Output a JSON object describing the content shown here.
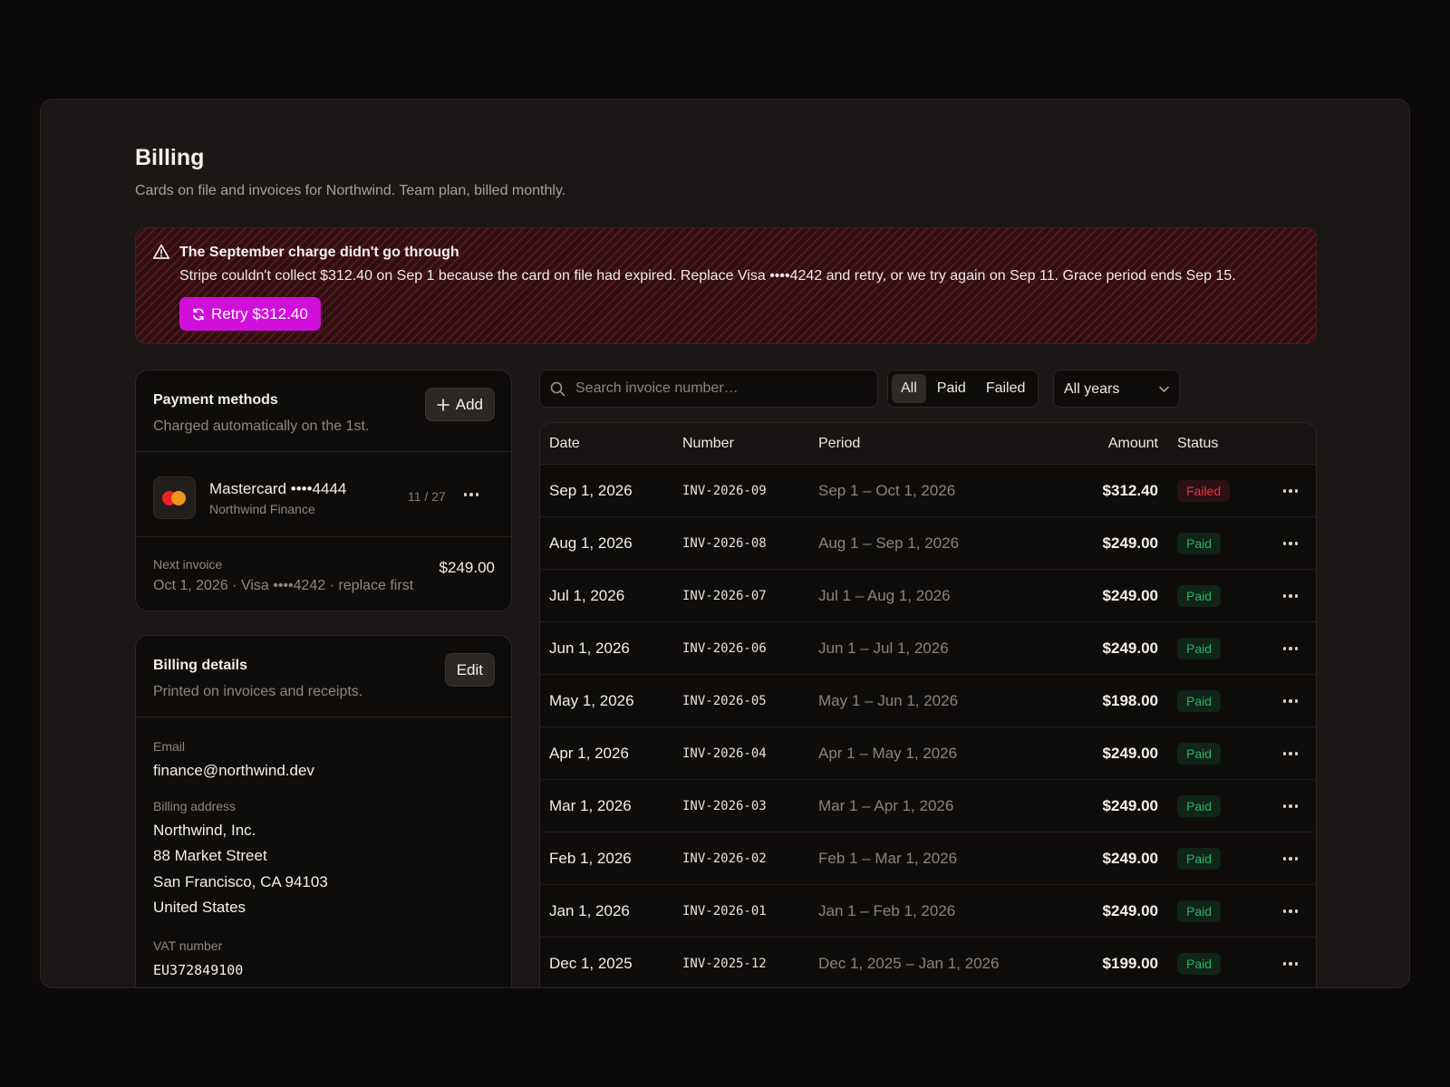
{
  "page": {
    "title": "Billing",
    "subtitle": "Cards on file and invoices for Northwind. Team plan, billed monthly."
  },
  "alert": {
    "icon": "warning-triangle-icon",
    "title": "The September charge didn't go through",
    "body": "Stripe couldn't collect $312.40 on Sep 1 because the card on file had expired. Replace Visa ••••4242 and retry, or we try again on Sep 11. Grace period ends Sep 15.",
    "retry_label": "Retry $312.40",
    "accent": "#d10fdb"
  },
  "payment_methods": {
    "title": "Payment methods",
    "subtitle": "Charged automatically on the 1st.",
    "add_label": "Add",
    "card": {
      "name": "Mastercard ••••4444",
      "owner": "Northwind Finance",
      "expiry": "11 / 27",
      "icon": "mastercard-logo-icon"
    },
    "next_invoice": {
      "label": "Next invoice",
      "detail": "Oct 1, 2026 · Visa ••••4242 · replace first",
      "amount": "$249.00"
    }
  },
  "billing_details": {
    "title": "Billing details",
    "subtitle": "Printed on invoices and receipts.",
    "edit_label": "Edit",
    "email_label": "Email",
    "email": "finance@northwind.dev",
    "address_label": "Billing address",
    "address": [
      "Northwind, Inc.",
      "88 Market Street",
      "San Francisco, CA 94103",
      "United States"
    ],
    "vat_label": "VAT number",
    "vat": "EU372849100"
  },
  "invoices": {
    "search_placeholder": "Search invoice number…",
    "filters": [
      "All",
      "Paid",
      "Failed"
    ],
    "active_filter": "All",
    "year_select": "All years",
    "columns": {
      "date": "Date",
      "number": "Number",
      "period": "Period",
      "amount": "Amount",
      "status": "Status"
    },
    "rows": [
      {
        "date": "Sep 1, 2026",
        "number": "INV-2026-09",
        "period": "Sep 1 – Oct 1, 2026",
        "amount": "$312.40",
        "status": "Failed"
      },
      {
        "date": "Aug 1, 2026",
        "number": "INV-2026-08",
        "period": "Aug 1 – Sep 1, 2026",
        "amount": "$249.00",
        "status": "Paid"
      },
      {
        "date": "Jul 1, 2026",
        "number": "INV-2026-07",
        "period": "Jul 1 – Aug 1, 2026",
        "amount": "$249.00",
        "status": "Paid"
      },
      {
        "date": "Jun 1, 2026",
        "number": "INV-2026-06",
        "period": "Jun 1 – Jul 1, 2026",
        "amount": "$249.00",
        "status": "Paid"
      },
      {
        "date": "May 1, 2026",
        "number": "INV-2026-05",
        "period": "May 1 – Jun 1, 2026",
        "amount": "$198.00",
        "status": "Paid"
      },
      {
        "date": "Apr 1, 2026",
        "number": "INV-2026-04",
        "period": "Apr 1 – May 1, 2026",
        "amount": "$249.00",
        "status": "Paid"
      },
      {
        "date": "Mar 1, 2026",
        "number": "INV-2026-03",
        "period": "Mar 1 – Apr 1, 2026",
        "amount": "$249.00",
        "status": "Paid"
      },
      {
        "date": "Feb 1, 2026",
        "number": "INV-2026-02",
        "period": "Feb 1 – Mar 1, 2026",
        "amount": "$249.00",
        "status": "Paid"
      },
      {
        "date": "Jan 1, 2026",
        "number": "INV-2026-01",
        "period": "Jan 1 – Feb 1, 2026",
        "amount": "$249.00",
        "status": "Paid"
      },
      {
        "date": "Dec 1, 2025",
        "number": "INV-2025-12",
        "period": "Dec 1, 2025 – Jan 1, 2026",
        "amount": "$199.00",
        "status": "Paid"
      }
    ]
  },
  "colors": {
    "background": "#0b0a09",
    "panel": "#1a1716",
    "paid": "#2bb26a",
    "failed": "#e8343f"
  }
}
